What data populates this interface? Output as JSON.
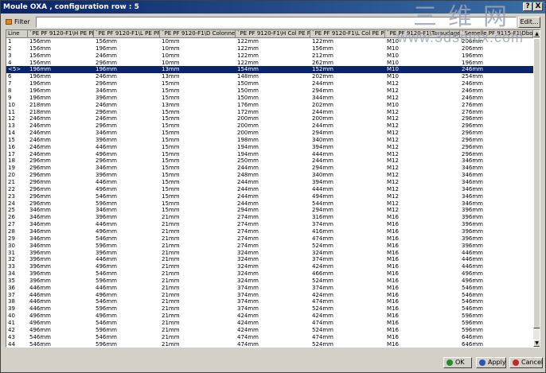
{
  "window": {
    "title": "Moule OXA , configuration row : 5",
    "help_label": "?",
    "close_label": "X"
  },
  "watermark": {
    "chinese": "三维网",
    "url": "www.3dsmax.com"
  },
  "filter": {
    "label": "Filter :",
    "value": "",
    "edit_label": "Edit..."
  },
  "table": {
    "headers": [
      "Line",
      "`PE PF 9120-F1\\H PE PF`",
      "`PE PF 9120-F1\\L PE PF`",
      "`PE PF 9120-F1\\D Colonne`",
      "`PE PF 9120-F1\\H Col PE PF`",
      "`PE PF 9120-F1\\L Col PE PF`",
      "`PE PF 9120-F1\\Taraudage`",
      "`Semelle PF 9115-F1\\Dbord`"
    ],
    "selected_index": 4,
    "rows": [
      [
        "1",
        "156mm",
        "156mm",
        "10mm",
        "122mm",
        "122mm",
        "M10",
        "206mm"
      ],
      [
        "2",
        "156mm",
        "196mm",
        "10mm",
        "122mm",
        "156mm",
        "M10",
        "206mm"
      ],
      [
        "3",
        "156mm",
        "246mm",
        "10mm",
        "122mm",
        "212mm",
        "M10",
        "196mm"
      ],
      [
        "4",
        "156mm",
        "296mm",
        "10mm",
        "122mm",
        "262mm",
        "M10",
        "196mm"
      ],
      [
        "<5>",
        "196mm",
        "196mm",
        "13mm",
        "154mm",
        "152mm",
        "M10",
        "246mm"
      ],
      [
        "6",
        "196mm",
        "246mm",
        "13mm",
        "148mm",
        "202mm",
        "M10",
        "254mm"
      ],
      [
        "7",
        "196mm",
        "296mm",
        "15mm",
        "150mm",
        "244mm",
        "M12",
        "246mm"
      ],
      [
        "8",
        "196mm",
        "346mm",
        "15mm",
        "150mm",
        "294mm",
        "M12",
        "246mm"
      ],
      [
        "9",
        "196mm",
        "396mm",
        "15mm",
        "150mm",
        "344mm",
        "M12",
        "246mm"
      ],
      [
        "10",
        "218mm",
        "246mm",
        "13mm",
        "176mm",
        "202mm",
        "M10",
        "276mm"
      ],
      [
        "11",
        "218mm",
        "296mm",
        "15mm",
        "172mm",
        "244mm",
        "M12",
        "276mm"
      ],
      [
        "12",
        "246mm",
        "246mm",
        "15mm",
        "200mm",
        "200mm",
        "M12",
        "296mm"
      ],
      [
        "13",
        "246mm",
        "296mm",
        "15mm",
        "200mm",
        "244mm",
        "M12",
        "296mm"
      ],
      [
        "14",
        "246mm",
        "346mm",
        "15mm",
        "200mm",
        "294mm",
        "M12",
        "296mm"
      ],
      [
        "15",
        "246mm",
        "396mm",
        "15mm",
        "198mm",
        "340mm",
        "M12",
        "296mm"
      ],
      [
        "16",
        "246mm",
        "446mm",
        "15mm",
        "194mm",
        "394mm",
        "M12",
        "296mm"
      ],
      [
        "17",
        "246mm",
        "496mm",
        "15mm",
        "194mm",
        "444mm",
        "M12",
        "296mm"
      ],
      [
        "18",
        "296mm",
        "296mm",
        "15mm",
        "250mm",
        "244mm",
        "M12",
        "346mm"
      ],
      [
        "19",
        "296mm",
        "346mm",
        "15mm",
        "244mm",
        "294mm",
        "M12",
        "346mm"
      ],
      [
        "20",
        "296mm",
        "396mm",
        "15mm",
        "248mm",
        "340mm",
        "M12",
        "346mm"
      ],
      [
        "21",
        "296mm",
        "446mm",
        "15mm",
        "244mm",
        "394mm",
        "M12",
        "346mm"
      ],
      [
        "22",
        "296mm",
        "496mm",
        "15mm",
        "244mm",
        "444mm",
        "M12",
        "346mm"
      ],
      [
        "23",
        "296mm",
        "546mm",
        "15mm",
        "244mm",
        "494mm",
        "M12",
        "346mm"
      ],
      [
        "24",
        "296mm",
        "596mm",
        "15mm",
        "244mm",
        "544mm",
        "M12",
        "346mm"
      ],
      [
        "25",
        "346mm",
        "346mm",
        "15mm",
        "294mm",
        "294mm",
        "M12",
        "396mm"
      ],
      [
        "26",
        "346mm",
        "396mm",
        "21mm",
        "274mm",
        "316mm",
        "M16",
        "396mm"
      ],
      [
        "27",
        "346mm",
        "446mm",
        "21mm",
        "274mm",
        "374mm",
        "M16",
        "396mm"
      ],
      [
        "28",
        "346mm",
        "496mm",
        "21mm",
        "274mm",
        "416mm",
        "M16",
        "396mm"
      ],
      [
        "29",
        "346mm",
        "546mm",
        "21mm",
        "274mm",
        "474mm",
        "M16",
        "396mm"
      ],
      [
        "30",
        "346mm",
        "596mm",
        "21mm",
        "274mm",
        "524mm",
        "M16",
        "396mm"
      ],
      [
        "31",
        "396mm",
        "396mm",
        "21mm",
        "324mm",
        "324mm",
        "M16",
        "446mm"
      ],
      [
        "32",
        "396mm",
        "446mm",
        "21mm",
        "324mm",
        "374mm",
        "M16",
        "446mm"
      ],
      [
        "33",
        "396mm",
        "496mm",
        "21mm",
        "324mm",
        "424mm",
        "M16",
        "446mm"
      ],
      [
        "34",
        "396mm",
        "546mm",
        "21mm",
        "324mm",
        "466mm",
        "M16",
        "496mm"
      ],
      [
        "35",
        "396mm",
        "596mm",
        "21mm",
        "324mm",
        "524mm",
        "M16",
        "496mm"
      ],
      [
        "36",
        "446mm",
        "446mm",
        "21mm",
        "374mm",
        "374mm",
        "M16",
        "546mm"
      ],
      [
        "37",
        "446mm",
        "496mm",
        "21mm",
        "374mm",
        "424mm",
        "M16",
        "546mm"
      ],
      [
        "38",
        "446mm",
        "546mm",
        "21mm",
        "374mm",
        "474mm",
        "M16",
        "546mm"
      ],
      [
        "39",
        "446mm",
        "596mm",
        "21mm",
        "374mm",
        "524mm",
        "M16",
        "546mm"
      ],
      [
        "40",
        "496mm",
        "496mm",
        "21mm",
        "424mm",
        "424mm",
        "M16",
        "596mm"
      ],
      [
        "41",
        "496mm",
        "546mm",
        "21mm",
        "424mm",
        "474mm",
        "M16",
        "596mm"
      ],
      [
        "42",
        "496mm",
        "596mm",
        "21mm",
        "424mm",
        "524mm",
        "M16",
        "596mm"
      ],
      [
        "43",
        "546mm",
        "546mm",
        "21mm",
        "474mm",
        "474mm",
        "M16",
        "646mm"
      ],
      [
        "44",
        "546mm",
        "596mm",
        "21mm",
        "474mm",
        "524mm",
        "M16",
        "646mm"
      ]
    ]
  },
  "footer": {
    "ok_label": "OK",
    "apply_label": "Apply",
    "cancel_label": "Cancel"
  },
  "colors": {
    "title_bar": "#0a246a",
    "selection": "#0a246a",
    "ok_icon": "#1f8f2a",
    "apply_icon": "#2a55b8",
    "cancel_icon": "#c0282a"
  }
}
